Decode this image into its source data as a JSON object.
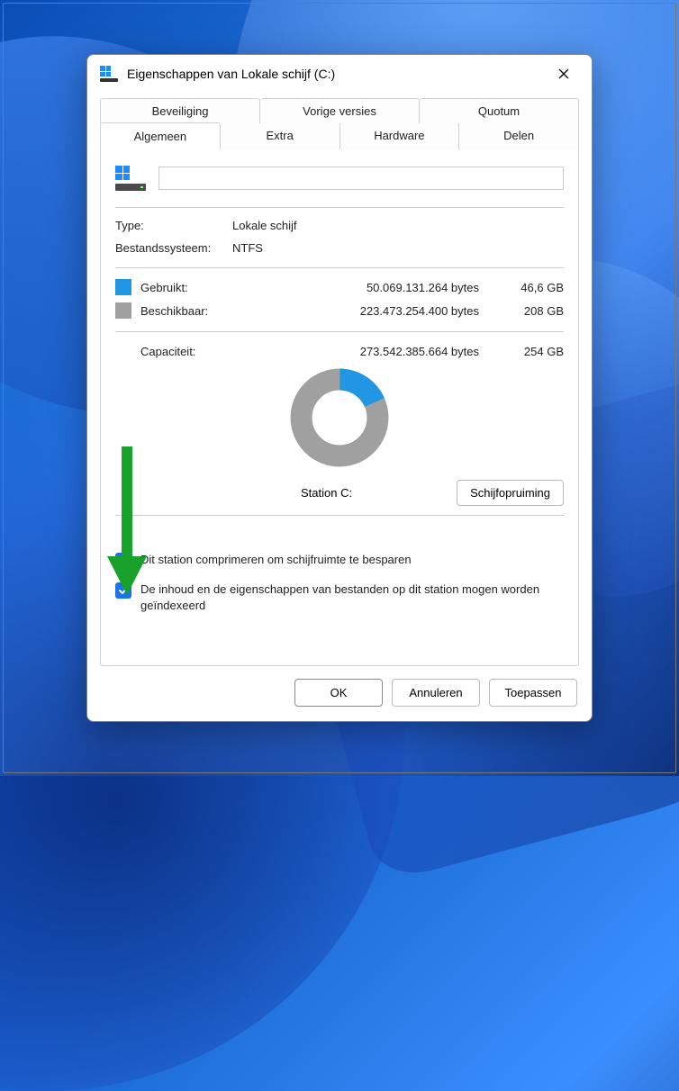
{
  "window": {
    "title": "Eigenschappen van Lokale schijf (C:)"
  },
  "tabs": {
    "row1": [
      "Beveiliging",
      "Vorige versies",
      "Quotum"
    ],
    "row2": [
      "Algemeen",
      "Extra",
      "Hardware",
      "Delen"
    ],
    "active": "Algemeen"
  },
  "drive": {
    "name_value": "",
    "type_label": "Type:",
    "type_value": "Lokale schijf",
    "fs_label": "Bestandssysteem:",
    "fs_value": "NTFS"
  },
  "usage": {
    "used_label": "Gebruikt:",
    "used_bytes": "50.069.131.264 bytes",
    "used_gb": "46,6 GB",
    "free_label": "Beschikbaar:",
    "free_bytes": "223.473.254.400 bytes",
    "free_gb": "208 GB",
    "capacity_label": "Capaciteit:",
    "capacity_bytes": "273.542.385.664 bytes",
    "capacity_gb": "254 GB",
    "station_label": "Station C:",
    "cleanup_button": "Schijfopruiming"
  },
  "checkboxes": {
    "compress": "Dit station comprimeren om schijfruimte te besparen",
    "index": "De inhoud en de eigenschappen van bestanden op dit station mogen worden geïndexeerd"
  },
  "buttons": {
    "ok": "OK",
    "cancel": "Annuleren",
    "apply": "Toepassen"
  },
  "colors": {
    "used": "#2196e3",
    "free": "#a0a0a0",
    "accent": "#1a73e8",
    "arrow": "#18a22b"
  },
  "chart_data": {
    "type": "pie",
    "title": "Station C:",
    "series": [
      {
        "name": "Gebruikt",
        "value": 46.6,
        "unit": "GB",
        "bytes": 50069131264,
        "color": "#2196e3"
      },
      {
        "name": "Beschikbaar",
        "value": 208,
        "unit": "GB",
        "bytes": 223473254400,
        "color": "#a0a0a0"
      }
    ],
    "total": {
      "name": "Capaciteit",
      "value": 254,
      "unit": "GB",
      "bytes": 273542385664
    }
  }
}
